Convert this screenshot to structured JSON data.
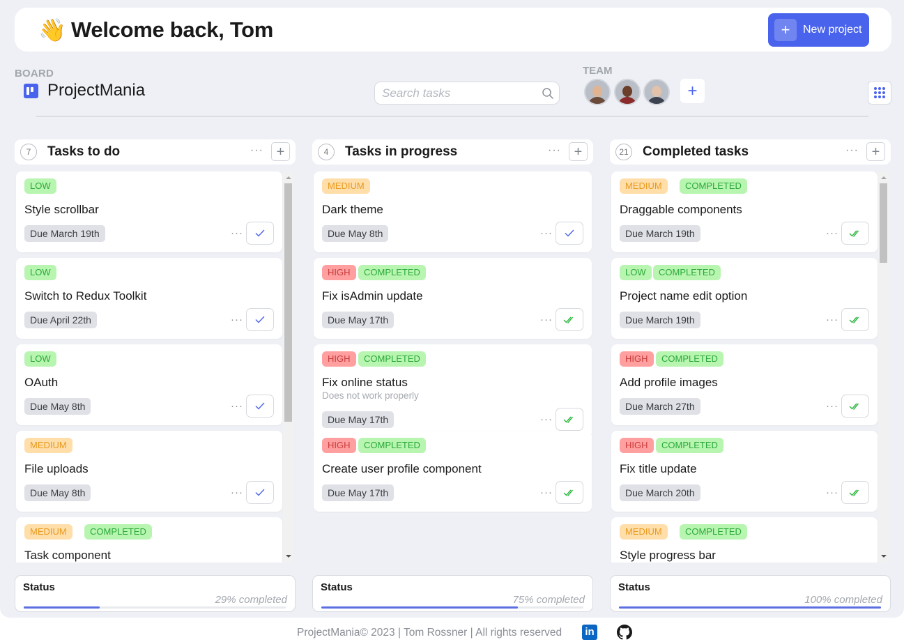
{
  "header": {
    "emoji": "👋",
    "welcome": "Welcome back, Tom",
    "new_project_label": "New project",
    "plus_glyph": "+"
  },
  "board": {
    "label": "BOARD",
    "title": "ProjectMania"
  },
  "search": {
    "placeholder": "Search tasks"
  },
  "team": {
    "label": "TEAM",
    "add_glyph": "+",
    "members": [
      {
        "name": "member-1",
        "skin": "#e0b493",
        "shirt": "#6b4a3a"
      },
      {
        "name": "member-2",
        "skin": "#6b3f2a",
        "shirt": "#8a2a2a"
      },
      {
        "name": "member-3",
        "skin": "#e2c2aa",
        "shirt": "#3c4250"
      }
    ]
  },
  "colors": {
    "accent": "#4a63ed",
    "low": "#b8f5b0",
    "medium": "#ffdeaa",
    "high": "#ff9f9f",
    "check_blue": "#4a63ed",
    "check_green": "#2bb63f"
  },
  "columns": [
    {
      "count": "7",
      "title": "Tasks to do",
      "dots": "···",
      "add": "+",
      "status_label": "Status",
      "status_text": "29% completed",
      "progress": 0.29,
      "cards": [
        {
          "tags": [
            {
              "text": "LOW",
              "kind": "low"
            }
          ],
          "title": "Style scrollbar",
          "due": "Due March 19th",
          "check": "single"
        },
        {
          "tags": [
            {
              "text": "LOW",
              "kind": "low"
            }
          ],
          "title": "Switch to Redux Toolkit",
          "due": "Due April 22th",
          "check": "single"
        },
        {
          "tags": [
            {
              "text": "LOW",
              "kind": "low"
            }
          ],
          "title": "OAuth",
          "due": "Due May 8th",
          "check": "single"
        },
        {
          "tags": [
            {
              "text": "MEDIUM",
              "kind": "medium"
            }
          ],
          "title": "File uploads",
          "due": "Due May 8th",
          "check": "single"
        },
        {
          "tags": [
            {
              "text": "MEDIUM",
              "kind": "medium"
            },
            {
              "text": "COMPLETED",
              "kind": "completed"
            }
          ],
          "title": "Task component",
          "due": "",
          "check": "double"
        }
      ]
    },
    {
      "count": "4",
      "title": "Tasks in progress",
      "dots": "···",
      "add": "+",
      "status_label": "Status",
      "status_text": "75% completed",
      "progress": 0.75,
      "cards": [
        {
          "tags": [
            {
              "text": "MEDIUM",
              "kind": "medium"
            }
          ],
          "title": "Dark theme",
          "due": "Due May 8th",
          "check": "single"
        },
        {
          "tags": [
            {
              "text": "HIGH",
              "kind": "high"
            },
            {
              "text": "COMPLETED",
              "kind": "completed"
            }
          ],
          "title": "Fix isAdmin update",
          "due": "Due May 17th",
          "check": "double"
        },
        {
          "tags": [
            {
              "text": "HIGH",
              "kind": "high"
            },
            {
              "text": "COMPLETED",
              "kind": "completed"
            }
          ],
          "title": "Fix online status",
          "description": "Does not work properly",
          "due": "Due May 17th",
          "check": "double"
        },
        {
          "tags": [
            {
              "text": "HIGH",
              "kind": "high"
            },
            {
              "text": "COMPLETED",
              "kind": "completed"
            }
          ],
          "title": "Create user profile component",
          "due": "Due May 17th",
          "check": "double"
        }
      ]
    },
    {
      "count": "21",
      "title": "Completed tasks",
      "dots": "···",
      "add": "+",
      "status_label": "Status",
      "status_text": "100% completed",
      "progress": 1.0,
      "cards": [
        {
          "tags": [
            {
              "text": "MEDIUM",
              "kind": "medium"
            },
            {
              "text": "COMPLETED",
              "kind": "completed"
            }
          ],
          "title": "Draggable components",
          "due": "Due March 19th",
          "check": "double"
        },
        {
          "tags": [
            {
              "text": "LOW",
              "kind": "low"
            },
            {
              "text": "COMPLETED",
              "kind": "completed"
            }
          ],
          "title": "Project name edit option",
          "due": "Due March 19th",
          "check": "double"
        },
        {
          "tags": [
            {
              "text": "HIGH",
              "kind": "high"
            },
            {
              "text": "COMPLETED",
              "kind": "completed"
            }
          ],
          "title": "Add profile images",
          "due": "Due March 27th",
          "check": "double"
        },
        {
          "tags": [
            {
              "text": "HIGH",
              "kind": "high"
            },
            {
              "text": "COMPLETED",
              "kind": "completed"
            }
          ],
          "title": "Fix title update",
          "due": "Due March 20th",
          "check": "double"
        },
        {
          "tags": [
            {
              "text": "MEDIUM",
              "kind": "medium"
            },
            {
              "text": "COMPLETED",
              "kind": "completed"
            }
          ],
          "title": "Style progress bar",
          "due": "",
          "check": "double"
        }
      ]
    }
  ],
  "footer": {
    "text": "ProjectMania© 2023 | Tom Rossner | All rights reserved",
    "linkedin_glyph": "in",
    "icons": [
      "linkedin-icon",
      "github-icon"
    ]
  }
}
